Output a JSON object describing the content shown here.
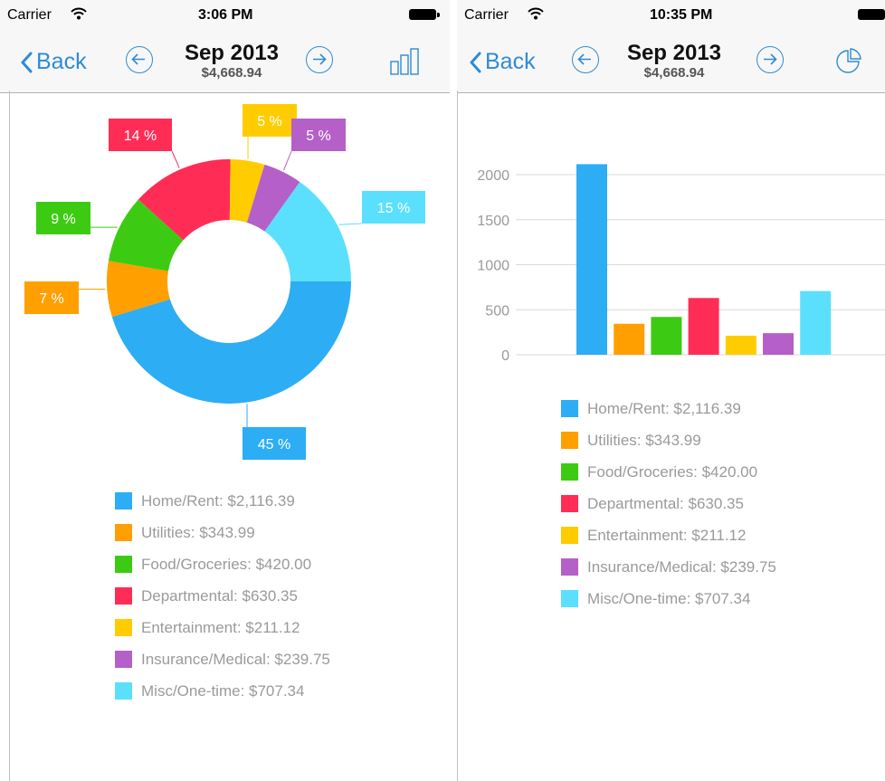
{
  "left": {
    "status": {
      "carrier": "Carrier",
      "time": "3:06 PM"
    },
    "nav": {
      "back_label": "Back",
      "title": "Sep 2013",
      "subtitle": "$4,668.94"
    }
  },
  "right": {
    "status": {
      "carrier": "Carrier",
      "time": "10:35 PM"
    },
    "nav": {
      "back_label": "Back",
      "title": "Sep 2013",
      "subtitle": "$4,668.94"
    }
  },
  "legend": [
    {
      "label": "Home/Rent: $2,116.39",
      "color": "#2dadf4"
    },
    {
      "label": "Utilities: $343.99",
      "color": "#ff9f00"
    },
    {
      "label": "Food/Groceries: $420.00",
      "color": "#3ccb12"
    },
    {
      "label": "Departmental: $630.35",
      "color": "#ff2d55"
    },
    {
      "label": "Entertainment: $211.12",
      "color": "#ffcc00"
    },
    {
      "label": "Insurance/Medical: $239.75",
      "color": "#b460c8"
    },
    {
      "label": "Misc/One-time: $707.34",
      "color": "#5ae0fc"
    }
  ],
  "chart_data": [
    {
      "type": "pie",
      "donut": true,
      "categories": [
        "Home/Rent",
        "Utilities",
        "Food/Groceries",
        "Departmental",
        "Entertainment",
        "Insurance/Medical",
        "Misc/One-time"
      ],
      "values": [
        2116.39,
        343.99,
        420.0,
        630.35,
        211.12,
        239.75,
        707.34
      ],
      "percent_labels": [
        "45 %",
        "7 %",
        "9 %",
        "14 %",
        "5 %",
        "5 %",
        "15 %"
      ],
      "colors": [
        "#2dadf4",
        "#ff9f00",
        "#3ccb12",
        "#ff2d55",
        "#ffcc00",
        "#b460c8",
        "#5ae0fc"
      ],
      "start": "3 o'clock",
      "direction": "clockwise"
    },
    {
      "type": "bar",
      "categories": [
        "Home/Rent",
        "Utilities",
        "Food/Groceries",
        "Departmental",
        "Entertainment",
        "Insurance/Medical",
        "Misc/One-time"
      ],
      "values": [
        2116.39,
        343.99,
        420.0,
        630.35,
        211.12,
        239.75,
        707.34
      ],
      "colors": [
        "#2dadf4",
        "#ff9f00",
        "#3ccb12",
        "#ff2d55",
        "#ffcc00",
        "#b460c8",
        "#5ae0fc"
      ],
      "yticks": [
        "0",
        "500",
        "1000",
        "1500",
        "2000"
      ],
      "ylim": [
        0,
        2000
      ],
      "grid": true
    }
  ]
}
